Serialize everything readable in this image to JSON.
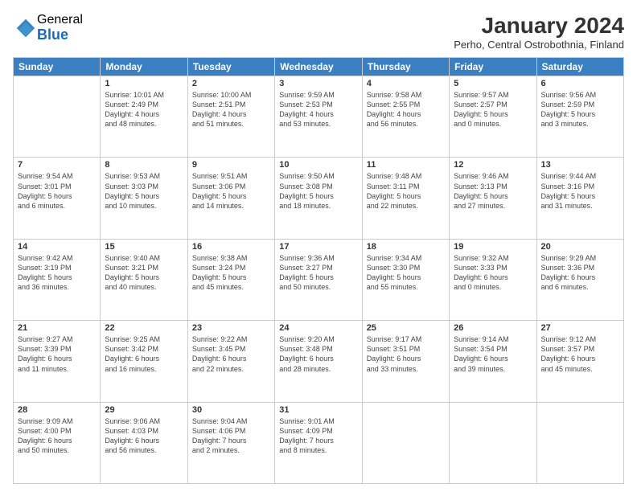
{
  "header": {
    "logo_general": "General",
    "logo_blue": "Blue",
    "month_title": "January 2024",
    "location": "Perho, Central Ostrobothnia, Finland"
  },
  "days_of_week": [
    "Sunday",
    "Monday",
    "Tuesday",
    "Wednesday",
    "Thursday",
    "Friday",
    "Saturday"
  ],
  "weeks": [
    [
      {
        "day": "",
        "info": ""
      },
      {
        "day": "1",
        "info": "Sunrise: 10:01 AM\nSunset: 2:49 PM\nDaylight: 4 hours\nand 48 minutes."
      },
      {
        "day": "2",
        "info": "Sunrise: 10:00 AM\nSunset: 2:51 PM\nDaylight: 4 hours\nand 51 minutes."
      },
      {
        "day": "3",
        "info": "Sunrise: 9:59 AM\nSunset: 2:53 PM\nDaylight: 4 hours\nand 53 minutes."
      },
      {
        "day": "4",
        "info": "Sunrise: 9:58 AM\nSunset: 2:55 PM\nDaylight: 4 hours\nand 56 minutes."
      },
      {
        "day": "5",
        "info": "Sunrise: 9:57 AM\nSunset: 2:57 PM\nDaylight: 5 hours\nand 0 minutes."
      },
      {
        "day": "6",
        "info": "Sunrise: 9:56 AM\nSunset: 2:59 PM\nDaylight: 5 hours\nand 3 minutes."
      }
    ],
    [
      {
        "day": "7",
        "info": "Sunrise: 9:54 AM\nSunset: 3:01 PM\nDaylight: 5 hours\nand 6 minutes."
      },
      {
        "day": "8",
        "info": "Sunrise: 9:53 AM\nSunset: 3:03 PM\nDaylight: 5 hours\nand 10 minutes."
      },
      {
        "day": "9",
        "info": "Sunrise: 9:51 AM\nSunset: 3:06 PM\nDaylight: 5 hours\nand 14 minutes."
      },
      {
        "day": "10",
        "info": "Sunrise: 9:50 AM\nSunset: 3:08 PM\nDaylight: 5 hours\nand 18 minutes."
      },
      {
        "day": "11",
        "info": "Sunrise: 9:48 AM\nSunset: 3:11 PM\nDaylight: 5 hours\nand 22 minutes."
      },
      {
        "day": "12",
        "info": "Sunrise: 9:46 AM\nSunset: 3:13 PM\nDaylight: 5 hours\nand 27 minutes."
      },
      {
        "day": "13",
        "info": "Sunrise: 9:44 AM\nSunset: 3:16 PM\nDaylight: 5 hours\nand 31 minutes."
      }
    ],
    [
      {
        "day": "14",
        "info": "Sunrise: 9:42 AM\nSunset: 3:19 PM\nDaylight: 5 hours\nand 36 minutes."
      },
      {
        "day": "15",
        "info": "Sunrise: 9:40 AM\nSunset: 3:21 PM\nDaylight: 5 hours\nand 40 minutes."
      },
      {
        "day": "16",
        "info": "Sunrise: 9:38 AM\nSunset: 3:24 PM\nDaylight: 5 hours\nand 45 minutes."
      },
      {
        "day": "17",
        "info": "Sunrise: 9:36 AM\nSunset: 3:27 PM\nDaylight: 5 hours\nand 50 minutes."
      },
      {
        "day": "18",
        "info": "Sunrise: 9:34 AM\nSunset: 3:30 PM\nDaylight: 5 hours\nand 55 minutes."
      },
      {
        "day": "19",
        "info": "Sunrise: 9:32 AM\nSunset: 3:33 PM\nDaylight: 6 hours\nand 0 minutes."
      },
      {
        "day": "20",
        "info": "Sunrise: 9:29 AM\nSunset: 3:36 PM\nDaylight: 6 hours\nand 6 minutes."
      }
    ],
    [
      {
        "day": "21",
        "info": "Sunrise: 9:27 AM\nSunset: 3:39 PM\nDaylight: 6 hours\nand 11 minutes."
      },
      {
        "day": "22",
        "info": "Sunrise: 9:25 AM\nSunset: 3:42 PM\nDaylight: 6 hours\nand 16 minutes."
      },
      {
        "day": "23",
        "info": "Sunrise: 9:22 AM\nSunset: 3:45 PM\nDaylight: 6 hours\nand 22 minutes."
      },
      {
        "day": "24",
        "info": "Sunrise: 9:20 AM\nSunset: 3:48 PM\nDaylight: 6 hours\nand 28 minutes."
      },
      {
        "day": "25",
        "info": "Sunrise: 9:17 AM\nSunset: 3:51 PM\nDaylight: 6 hours\nand 33 minutes."
      },
      {
        "day": "26",
        "info": "Sunrise: 9:14 AM\nSunset: 3:54 PM\nDaylight: 6 hours\nand 39 minutes."
      },
      {
        "day": "27",
        "info": "Sunrise: 9:12 AM\nSunset: 3:57 PM\nDaylight: 6 hours\nand 45 minutes."
      }
    ],
    [
      {
        "day": "28",
        "info": "Sunrise: 9:09 AM\nSunset: 4:00 PM\nDaylight: 6 hours\nand 50 minutes."
      },
      {
        "day": "29",
        "info": "Sunrise: 9:06 AM\nSunset: 4:03 PM\nDaylight: 6 hours\nand 56 minutes."
      },
      {
        "day": "30",
        "info": "Sunrise: 9:04 AM\nSunset: 4:06 PM\nDaylight: 7 hours\nand 2 minutes."
      },
      {
        "day": "31",
        "info": "Sunrise: 9:01 AM\nSunset: 4:09 PM\nDaylight: 7 hours\nand 8 minutes."
      },
      {
        "day": "",
        "info": ""
      },
      {
        "day": "",
        "info": ""
      },
      {
        "day": "",
        "info": ""
      }
    ]
  ]
}
